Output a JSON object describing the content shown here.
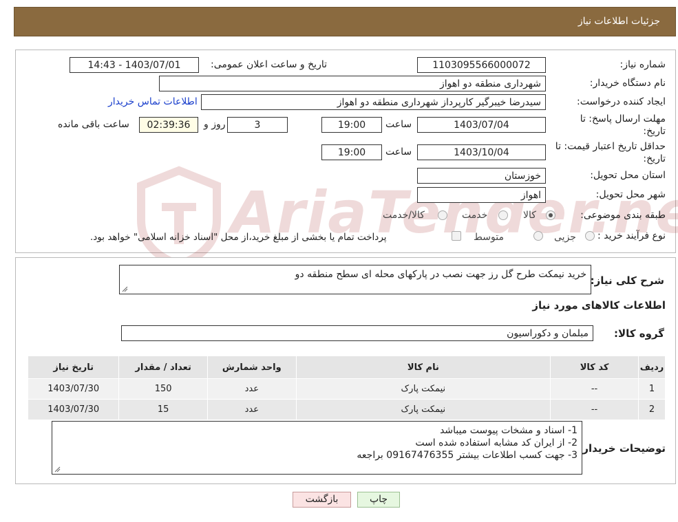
{
  "header": {
    "title": "جزئیات اطلاعات نیاز"
  },
  "fields": {
    "need_number_label": "شماره نیاز:",
    "need_number": "1103095566000072",
    "announce_label": "تاریخ و ساعت اعلان عمومی:",
    "announce_value": "1403/07/01 - 14:43",
    "buyer_org_label": "نام دستگاه خریدار:",
    "buyer_org": "شهرداری منطقه دو اهواز",
    "creator_label": "ایجاد کننده درخواست:",
    "creator": "سیدرضا خیبرگیر کارپرداز  شهرداری منطقه دو اهواز",
    "contact_link": "اطلاعات تماس خریدار",
    "deadline_label_1": "مهلت ارسال پاسخ: تا",
    "deadline_label_2": "تاریخ:",
    "deadline_date": "1403/07/04",
    "time_label": "ساعت",
    "deadline_time": "19:00",
    "days_value": "3",
    "days_label": "روز و",
    "remaining_time": "02:39:36",
    "remaining_label": "ساعت باقی مانده",
    "validity_label_1": "حداقل تاریخ اعتبار قیمت: تا",
    "validity_label_2": "تاریخ:",
    "validity_date": "1403/10/04",
    "validity_time_label": "ساعت",
    "validity_time": "19:00",
    "province_label": "استان محل تحویل:",
    "province": "خوزستان",
    "city_label": "شهر محل تحویل:",
    "city": "اهواز",
    "category_label": "طبقه بندی موضوعی:",
    "category_options": [
      "کالا",
      "خدمت",
      "کالا/خدمت"
    ],
    "process_label": "نوع فرآیند خرید :",
    "process_options": [
      "جزیی",
      "متوسط"
    ],
    "process_note": "پرداخت تمام یا بخشی از مبلغ خرید،از محل \"اسناد خزانه اسلامی\" خواهد بود."
  },
  "description": {
    "label": "شرح کلی نیاز:",
    "value": "خرید نیمکت طرح گل رز جهت نصب در پارکهای محله ای سطح منطقه دو"
  },
  "goods_title": "اطلاعات کالاهای مورد نیاز",
  "goods_group": {
    "label": "گروه کالا:",
    "value": "مبلمان و دکوراسیون"
  },
  "table": {
    "headers": [
      "ردیف",
      "کد کالا",
      "نام کالا",
      "واحد شمارش",
      "تعداد / مقدار",
      "تاریخ نیاز"
    ],
    "rows": [
      [
        "1",
        "--",
        "نیمکت پارک",
        "عدد",
        "150",
        "1403/07/30"
      ],
      [
        "2",
        "--",
        "نیمکت پارک",
        "عدد",
        "15",
        "1403/07/30"
      ]
    ]
  },
  "buyer_notes": {
    "label": "توضیحات خریدار:",
    "lines": [
      "1- اسناد و مشخات پیوست میباشد",
      "2- از ایران کد مشابه استفاده شده است",
      "3- جهت کسب اطلاعات بیشتر 09167476355 براجعه"
    ]
  },
  "buttons": {
    "print": "چاپ",
    "back": "بازگشت"
  },
  "watermark": {
    "text": "AriaTender.neT"
  },
  "colors": {
    "header": "#8a6a3f",
    "link": "#1a3fcc",
    "print_bg": "#e6f7e0",
    "back_bg": "#fbe3e3"
  }
}
